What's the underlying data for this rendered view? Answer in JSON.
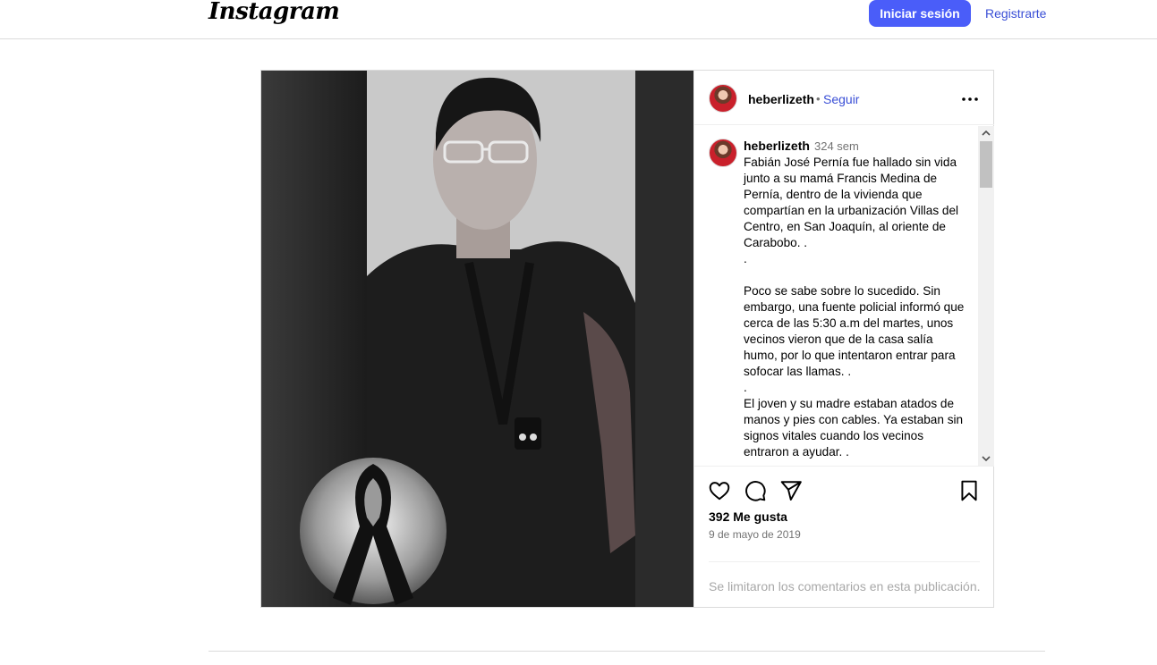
{
  "nav": {
    "logo": "Instagram",
    "login_label": "Iniciar sesión",
    "signup_label": "Registrarte"
  },
  "post": {
    "username": "heberlizeth",
    "separator": "•",
    "follow_label": "Seguir",
    "caption": {
      "username": "heberlizeth",
      "time_ago": "324 sem",
      "text": "Fabián José Pernía fue hallado sin vida junto a su mamá Francis Medina de Pernía, dentro de la vivienda que compartían en la urbanización Villas del Centro, en San Joaquín, al oriente de Carabobo. .\n.\n\nPoco se sabe sobre lo sucedido. Sin embargo, una fuente policial informó que cerca de las 5:30 a.m del martes, unos vecinos vieron que de la casa salía humo, por lo que intentaron entrar para sofocar las llamas. .\n.\nEl joven y su madre estaban atados de manos y pies con cables. Ya estaban sin signos vitales cuando los vecinos entraron a ayudar. ."
    },
    "likes": "392 Me gusta",
    "date": "9 de mayo de 2019",
    "comments_disabled": "Se limitaron los comentarios en esta publicación."
  },
  "icons": {
    "more": "more-horizontal-icon",
    "like": "heart-icon",
    "comment": "comment-icon",
    "share": "send-icon",
    "save": "bookmark-icon"
  },
  "colors": {
    "accent": "#4a5df9",
    "link": "#3a4fd6",
    "muted": "#737373",
    "border": "#dbdbdb"
  }
}
